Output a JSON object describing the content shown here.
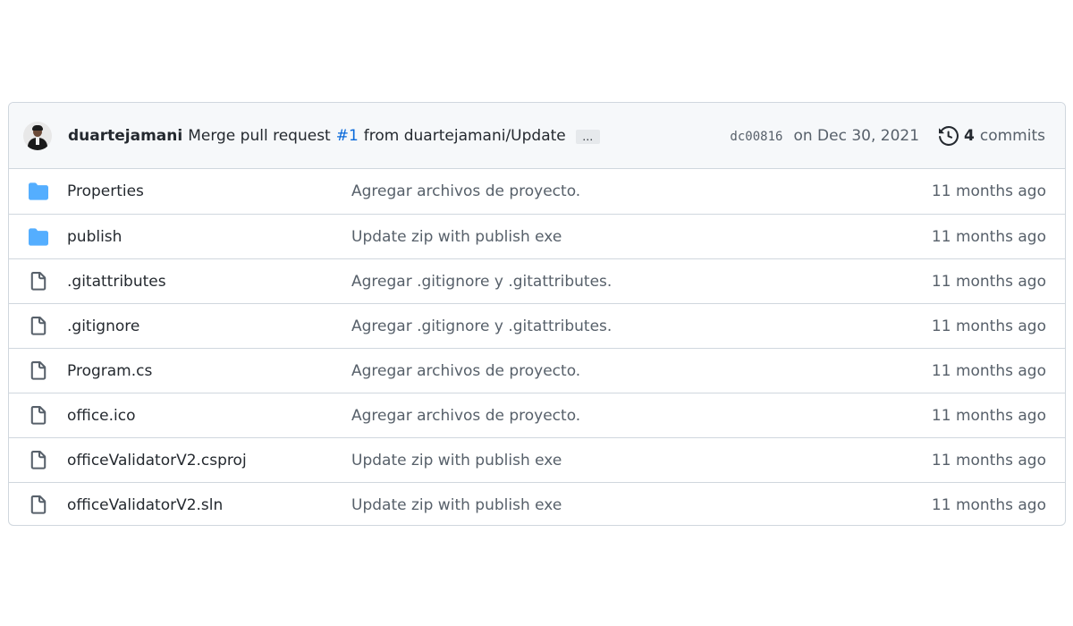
{
  "commit": {
    "author": "duartejamani",
    "message_prefix": "Merge pull request",
    "pr_link": "#1",
    "message_suffix": "from duartejamani/Update",
    "ellipsis": "…",
    "sha": "dc00816",
    "date": "on Dec 30, 2021",
    "commits_count": "4",
    "commits_label": "commits"
  },
  "colors": {
    "folder": "#54aeff",
    "file": "#57606a",
    "link": "#0969da"
  },
  "files": [
    {
      "type": "folder-icon",
      "name": "Properties",
      "message": "Agregar archivos de proyecto.",
      "age": "11 months ago"
    },
    {
      "type": "folder-icon",
      "name": "publish",
      "message": "Update zip with publish exe",
      "age": "11 months ago"
    },
    {
      "type": "file-icon",
      "name": ".gitattributes",
      "message": "Agregar .gitignore y .gitattributes.",
      "age": "11 months ago"
    },
    {
      "type": "file-icon",
      "name": ".gitignore",
      "message": "Agregar .gitignore y .gitattributes.",
      "age": "11 months ago"
    },
    {
      "type": "file-icon",
      "name": "Program.cs",
      "message": "Agregar archivos de proyecto.",
      "age": "11 months ago"
    },
    {
      "type": "file-icon",
      "name": "office.ico",
      "message": "Agregar archivos de proyecto.",
      "age": "11 months ago"
    },
    {
      "type": "file-icon",
      "name": "officeValidatorV2.csproj",
      "message": "Update zip with publish exe",
      "age": "11 months ago"
    },
    {
      "type": "file-icon",
      "name": "officeValidatorV2.sln",
      "message": "Update zip with publish exe",
      "age": "11 months ago"
    }
  ]
}
